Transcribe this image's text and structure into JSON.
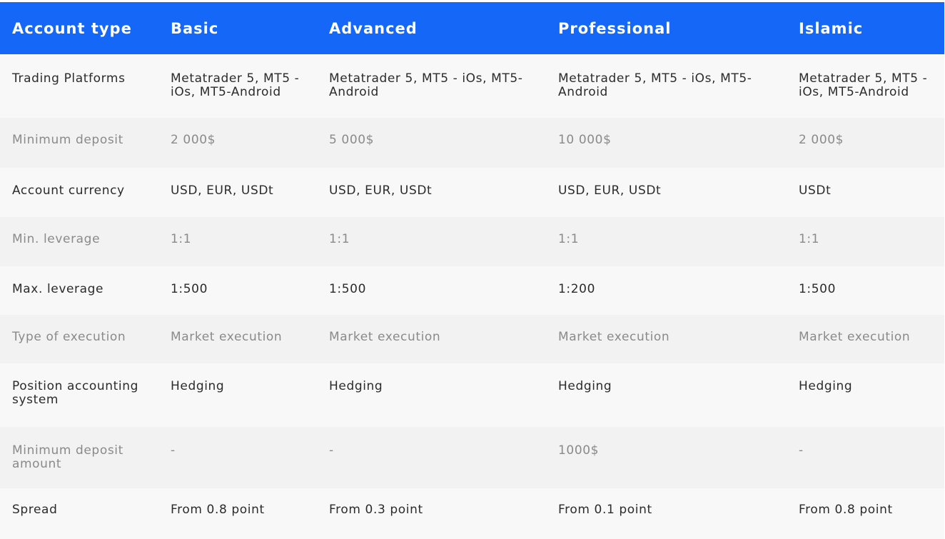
{
  "table": {
    "headers": [
      "Account type",
      "Basic",
      "Advanced",
      "Professional",
      "Islamic"
    ],
    "rows": [
      {
        "label": "Trading Platforms",
        "values": [
          "Metatrader 5, MT5 - iOs, MT5-Android",
          "Metatrader 5, MT5 - iOs, MT5-Android",
          "Metatrader 5, MT5 - iOs, MT5-Android",
          "Metatrader 5, MT5 - iOs, MT5-Android"
        ]
      },
      {
        "label": "Minimum deposit",
        "values": [
          "2 000$",
          "5 000$",
          "10 000$",
          "2 000$"
        ]
      },
      {
        "label": "Account currency",
        "values": [
          "USD, EUR, USDt",
          "USD, EUR, USDt",
          "USD, EUR, USDt",
          "USDt"
        ]
      },
      {
        "label": "Min. leverage",
        "values": [
          "1:1",
          "1:1",
          "1:1",
          "1:1"
        ]
      },
      {
        "label": "Max. leverage",
        "values": [
          "1:500",
          "1:500",
          "1:200",
          "1:500"
        ]
      },
      {
        "label": "Type of execution",
        "values": [
          "Market execution",
          "Market execution",
          "Market execution",
          "Market execution"
        ]
      },
      {
        "label": "Position accounting system",
        "values": [
          "Hedging",
          "Hedging",
          "Hedging",
          "Hedging"
        ]
      },
      {
        "label": "Minimum deposit amount",
        "values": [
          "-",
          "-",
          "1000$",
          "-"
        ]
      },
      {
        "label": "Spread",
        "values": [
          "From 0.8 point",
          "From 0.3 point",
          "From 0.1 point",
          "From 0.8 point"
        ]
      }
    ]
  },
  "colors": {
    "header_bg": "#1467f7",
    "header_text": "#ffffff",
    "row_odd_bg": "#f8f8f8",
    "row_even_bg": "#f2f2f2",
    "text_dark": "#2b2b2b",
    "text_muted": "#8a8a8a"
  }
}
